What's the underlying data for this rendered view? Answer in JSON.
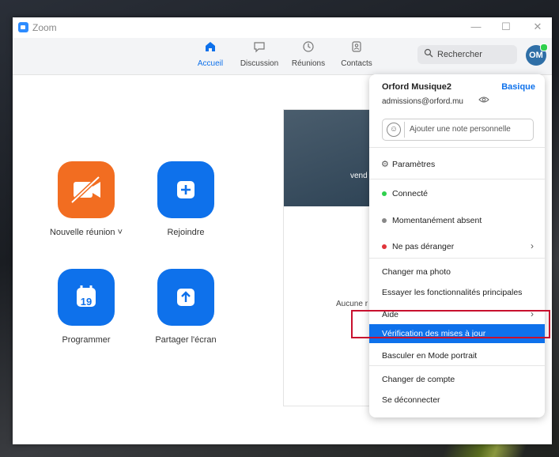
{
  "window": {
    "title": "Zoom"
  },
  "window_controls": {
    "minimize": "—",
    "maximize": "☐",
    "close": "✕"
  },
  "nav": {
    "tabs": [
      {
        "label": "Accueil",
        "icon": "home-icon",
        "active": true
      },
      {
        "label": "Discussion",
        "icon": "chat-icon",
        "active": false
      },
      {
        "label": "Réunions",
        "icon": "clock-icon",
        "active": false
      },
      {
        "label": "Contacts",
        "icon": "contacts-icon",
        "active": false
      }
    ],
    "search_placeholder": "Rechercher",
    "avatar_initials": "OM"
  },
  "home": {
    "actions": [
      {
        "label": "Nouvelle réunion",
        "icon": "video-off-icon",
        "color": "#f26d21",
        "dropdown": "˅"
      },
      {
        "label": "Rejoindre",
        "icon": "plus-icon",
        "color": "#0e71eb"
      },
      {
        "label": "Programmer",
        "icon": "calendar-icon",
        "color": "#0e71eb",
        "calendar_day": "19"
      },
      {
        "label": "Partager l'écran",
        "icon": "share-up-icon",
        "color": "#0e71eb"
      }
    ],
    "card": {
      "date_fragment": "vend",
      "empty_fragment": "Aucune r"
    }
  },
  "profile_menu": {
    "name": "Orford Musique2",
    "plan": "Basique",
    "email": "admissions@orford.mu",
    "note_placeholder": "Ajouter une note personnelle",
    "items": [
      {
        "label": "Paramètres",
        "icon": "gear-icon"
      },
      {
        "label": "Connecté",
        "status_color": "#2fd04d"
      },
      {
        "label": "Momentanément absent",
        "status_color": "#888888"
      },
      {
        "label": "Ne pas déranger",
        "status_color": "#e0343a",
        "submenu": true
      },
      {
        "label": "Changer ma photo"
      },
      {
        "label": "Essayer les fonctionnalités principales"
      },
      {
        "label": "Aide",
        "submenu": true
      },
      {
        "label": "Vérification des mises à jour",
        "highlighted": true
      },
      {
        "label": "Basculer en Mode portrait"
      },
      {
        "label": "Changer de compte"
      },
      {
        "label": "Se déconnecter"
      }
    ]
  },
  "colors": {
    "accent": "#0e71eb",
    "highlight_outline": "#c8102e"
  }
}
